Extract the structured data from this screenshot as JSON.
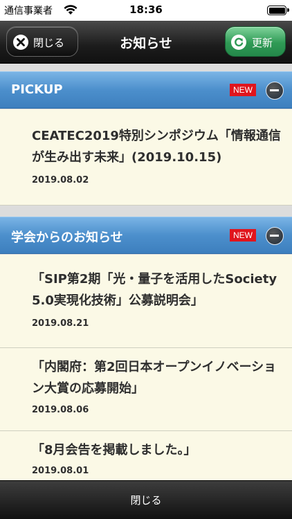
{
  "status_bar": {
    "carrier": "通信事業者",
    "time": "18:36",
    "wifi_icon": "wifi-icon",
    "battery_icon": "battery-icon"
  },
  "nav": {
    "title": "お知らせ",
    "close_label": "閉じる",
    "close_icon": "close-icon",
    "refresh_label": "更新",
    "refresh_icon": "refresh-icon",
    "refresh_color": "#2f9a55"
  },
  "sections": [
    {
      "title": "PICKUP",
      "badge": "NEW",
      "items": [
        {
          "title": "CEATEC2019特別シンポジウム「情報通信が生み出す未来」(2019.10.15)",
          "date": "2019.08.02"
        }
      ]
    },
    {
      "title": "学会からのお知らせ",
      "badge": "NEW",
      "items": [
        {
          "title": "「SIP第2期「光・量子を活用したSociety 5.0実現化技術」公募説明会」",
          "date": "2019.08.21"
        },
        {
          "title": "「内閣府：第2回日本オープンイノベーション大賞の応募開始」",
          "date": "2019.08.06"
        },
        {
          "title": "「8月会告を掲載しました。」",
          "date": "2019.08.01"
        }
      ]
    }
  ],
  "bottom_bar": {
    "close_label": "閉じる"
  },
  "colors": {
    "section_header": "#4c8fcc",
    "badge_new": "#e0151d",
    "item_bg": "#fbf9e6"
  }
}
